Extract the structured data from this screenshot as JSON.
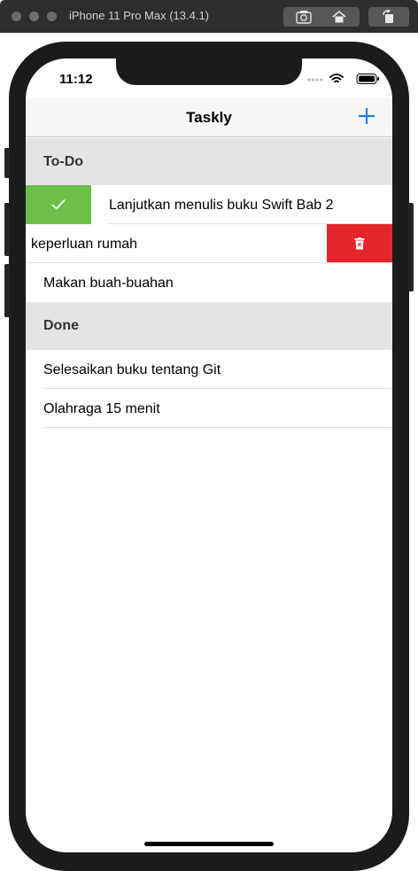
{
  "window": {
    "title": "iPhone 11 Pro Max (13.4.1)"
  },
  "toolbar": {
    "screenshot_icon": "camera-icon",
    "home_icon": "home-icon",
    "rotate_icon": "rotate-icon"
  },
  "status_bar": {
    "time": "11:12"
  },
  "nav": {
    "title": "Taskly",
    "add_icon": "plus-icon"
  },
  "sections": [
    {
      "title": "To-Do",
      "items": [
        {
          "label": "Lanjutkan menulis buku Swift Bab 2",
          "swipe_action": "complete",
          "action_icon": "checkmark-icon"
        },
        {
          "label": "keperluan rumah",
          "swipe_action": "delete",
          "action_icon": "trash-icon"
        },
        {
          "label": "Makan buah-buahan"
        }
      ]
    },
    {
      "title": "Done",
      "items": [
        {
          "label": "Selesaikan buku tentang Git"
        },
        {
          "label": "Olahraga 15 menit"
        }
      ]
    }
  ],
  "colors": {
    "accent": "#0a7aff",
    "complete": "#6cc04a",
    "delete": "#e3262b",
    "section_bg": "#e4e4e4"
  }
}
